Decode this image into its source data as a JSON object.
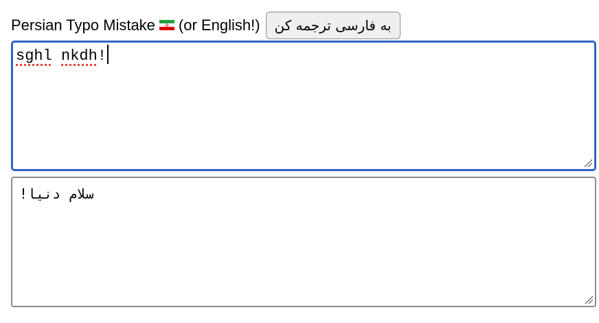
{
  "header": {
    "label_prefix": "Persian Typo Mistake",
    "flag_icon": "iran-flag-icon",
    "label_suffix": "(or English!)",
    "translate_button": "به فارسی ترجمه کن"
  },
  "input": {
    "word1": "sghl",
    "word2": "nkdh",
    "punct": "!"
  },
  "output": {
    "value": "سلام دنیا!"
  },
  "colors": {
    "focus_border": "#2f63c8",
    "misspell_underline": "#e0443c",
    "button_bg": "#efefef"
  }
}
